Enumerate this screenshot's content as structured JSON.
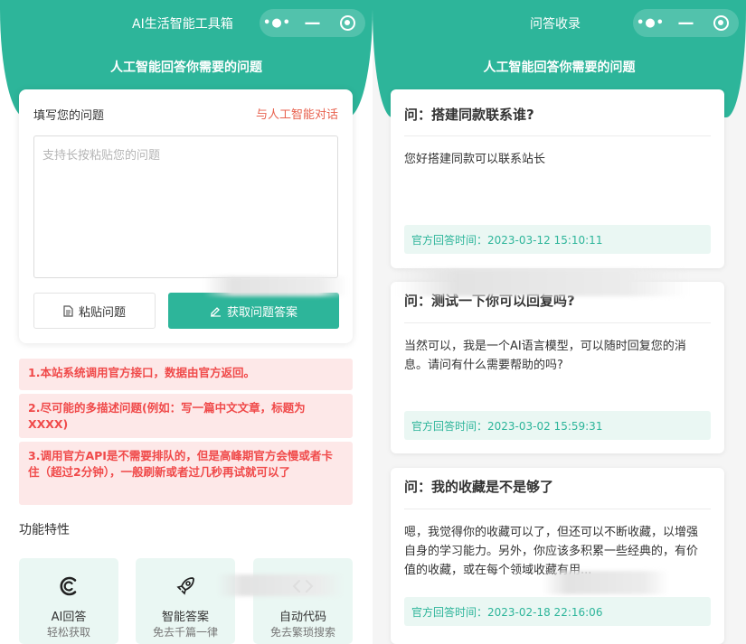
{
  "left": {
    "header": {
      "title": "AI生活智能工具箱",
      "subtitle": "人工智能回答你需要的问题",
      "capsule": {
        "more": "•●•",
        "minimize": "—"
      }
    },
    "form": {
      "label": "填写您的问题",
      "link": "与人工智能对话",
      "placeholder": "支持长按粘贴您的问题",
      "paste_label": "粘贴问题",
      "get_label": "获取问题答案"
    },
    "notices": [
      "1.本站系统调用官方接口，数据由官方返回。",
      "2.尽可能的多描述问题(例如：写一篇中文文章，标题为XXXX)",
      "3.调用官方API是不需要排队的，但是高峰期官方会慢或者卡住（超过2分钟），一般刷新或者过几秒再试就可以了"
    ],
    "section_title": "功能特性",
    "features": [
      {
        "title": "AI回答",
        "sub": "轻松获取",
        "icon": "ai-c-icon"
      },
      {
        "title": "智能答案",
        "sub": "免去千篇一律",
        "icon": "rocket-icon"
      },
      {
        "title": "自动代码",
        "sub": "免去繁琐搜索",
        "icon": "code-icon"
      }
    ]
  },
  "right": {
    "header": {
      "title": "问答收录",
      "subtitle": "人工智能回答你需要的问题",
      "capsule": {
        "more": "•●•",
        "minimize": "—"
      }
    },
    "cards": [
      {
        "question": "问：搭建同款联系谁?",
        "answer": "您好搭建同款可以联系站长",
        "time": "官方回答时间：2023-03-12 15:10:11"
      },
      {
        "question": "问：测试一下你可以回复吗?",
        "answer": "当然可以，我是一个AI语言模型，可以随时回复您的消息。请问有什么需要帮助的吗?",
        "time": "官方回答时间：2023-03-02 15:59:31"
      },
      {
        "question": "问：我的收藏是不是够了",
        "answer": "嗯，我觉得你的收藏可以了，但还可以不断收藏，以增强自身的学习能力。另外，你应该多积累一些经典的，有价值的收藏，或在每个领域收藏有用...",
        "time": "官方回答时间：2023-02-18 22:16:06"
      }
    ]
  },
  "colors": {
    "accent": "#2db59a",
    "link": "#e8624f",
    "notice_bg": "#fde8e8",
    "notice_text": "#f04a4a",
    "feature_bg": "#eaf7f3"
  }
}
